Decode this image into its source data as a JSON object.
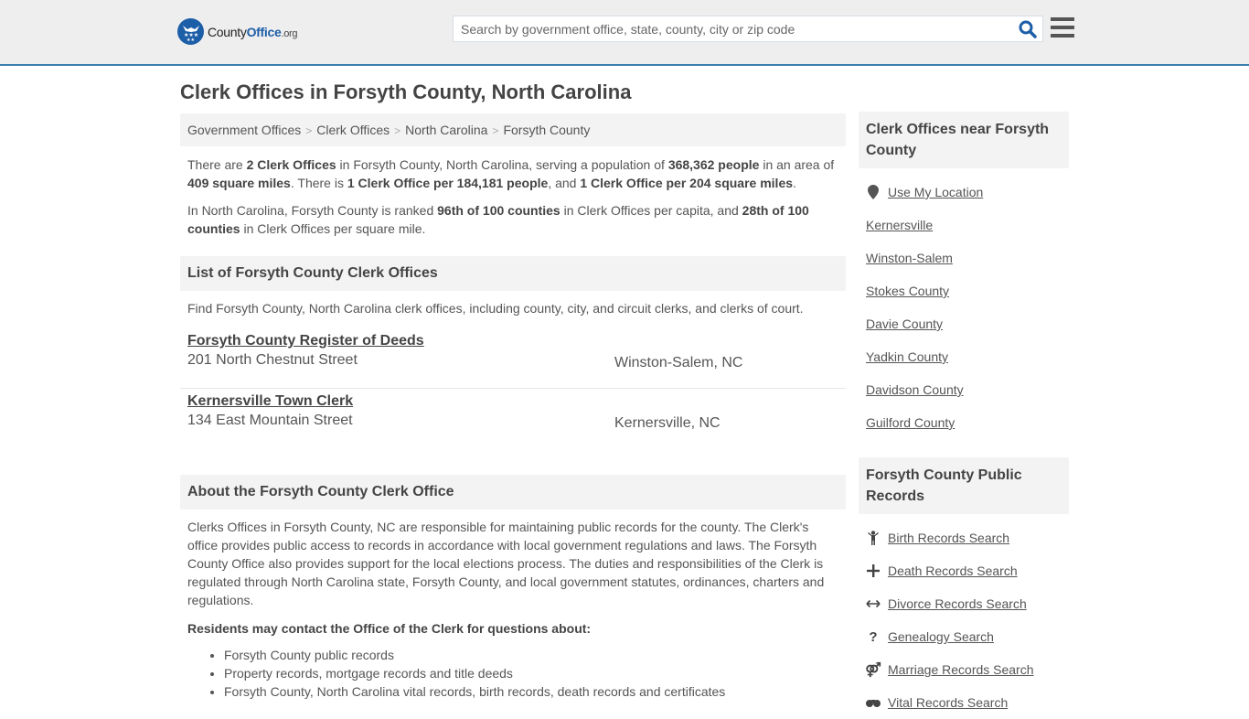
{
  "header": {
    "logo": {
      "part1": "County",
      "part2": "Office",
      "part3": ".org"
    },
    "search_placeholder": "Search by government office, state, county, city or zip code",
    "brand_color": "#1d5ea8",
    "accent_border_color": "#3b7eae"
  },
  "page_title": "Clerk Offices in Forsyth County, North Carolina",
  "breadcrumb": [
    "Government Offices",
    "Clerk Offices",
    "North Carolina",
    "Forsyth County"
  ],
  "summary": {
    "p1": {
      "t1": "There are ",
      "b1": "2 Clerk Offices",
      "t2": " in Forsyth County, North Carolina, serving a population of ",
      "b2": "368,362 people",
      "t3": " in an area of ",
      "b3": "409 square miles",
      "t4": ". There is ",
      "b4": "1 Clerk Office per 184,181 people",
      "t5": ", and ",
      "b5": "1 Clerk Office per 204 square miles",
      "t6": "."
    },
    "p2": {
      "t1": "In North Carolina, Forsyth County is ranked ",
      "b1": "96th of 100 counties",
      "t2": " in Clerk Offices per capita, and ",
      "b2": "28th of 100 counties",
      "t3": " in Clerk Offices per square mile."
    }
  },
  "list_section": {
    "heading": "List of Forsyth County Clerk Offices",
    "intro": "Find Forsyth County, North Carolina clerk offices, including county, city, and circuit clerks, and clerks of court.",
    "offices": [
      {
        "name": "Forsyth County Register of Deeds",
        "address": "201 North Chestnut Street",
        "city": "Winston-Salem, NC"
      },
      {
        "name": "Kernersville Town Clerk",
        "address": "134 East Mountain Street",
        "city": "Kernersville, NC"
      }
    ]
  },
  "about_section": {
    "heading": "About the Forsyth County Clerk Office",
    "body": "Clerks Offices in Forsyth County, NC are responsible for maintaining public records for the county. The Clerk's office provides public access to records in accordance with local government regulations and laws. The Forsyth County Office also provides support for the local elections process. The duties and responsibilities of the Clerk is regulated through North Carolina state, Forsyth County, and local government statutes, ordinances, charters and regulations.",
    "subheading": "Residents may contact the Office of the Clerk for questions about:",
    "bullets": [
      "Forsyth County public records",
      "Property records, mortgage records and title deeds",
      "Forsyth County, North Carolina vital records, birth records, death records and certificates"
    ]
  },
  "sidebar": {
    "nearby_heading": "Clerk Offices near Forsyth County",
    "use_location": "Use My Location",
    "nearby": [
      "Kernersville",
      "Winston-Salem",
      "Stokes County",
      "Davie County",
      "Yadkin County",
      "Davidson County",
      "Guilford County"
    ],
    "records_heading": "Forsyth County Public Records",
    "records": [
      {
        "label": "Birth Records Search",
        "icon": "child-icon"
      },
      {
        "label": "Death Records Search",
        "icon": "plus-icon"
      },
      {
        "label": "Divorce Records Search",
        "icon": "arrows-horizontal-icon"
      },
      {
        "label": "Genealogy Search",
        "icon": "question-icon"
      },
      {
        "label": "Marriage Records Search",
        "icon": "venus-mars-icon"
      },
      {
        "label": "Vital Records Search",
        "icon": "binoculars-icon"
      }
    ]
  }
}
